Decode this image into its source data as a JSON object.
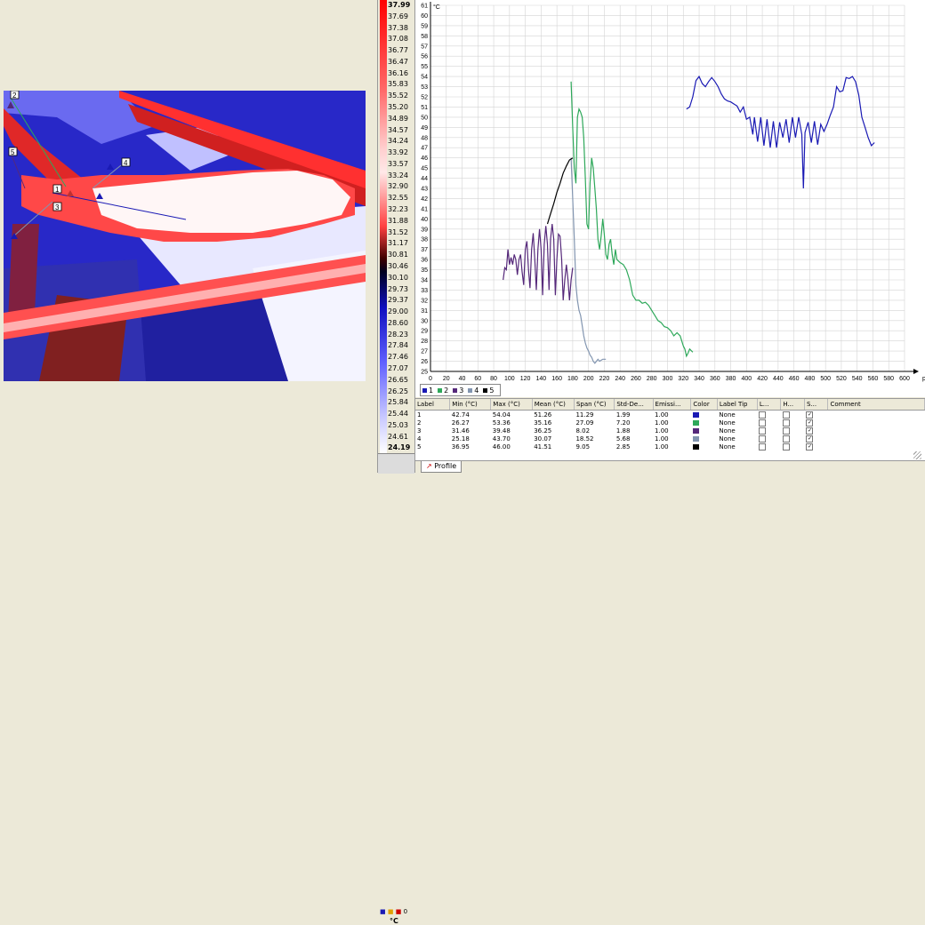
{
  "palette": {
    "ticks": [
      "37.99",
      "37.69",
      "37.38",
      "37.08",
      "36.77",
      "36.47",
      "36.16",
      "35.83",
      "35.52",
      "35.20",
      "34.89",
      "34.57",
      "34.24",
      "33.92",
      "33.57",
      "33.24",
      "32.90",
      "32.55",
      "32.23",
      "31.88",
      "31.52",
      "31.17",
      "30.81",
      "30.46",
      "30.10",
      "29.73",
      "29.37",
      "29.00",
      "28.60",
      "28.23",
      "27.84",
      "27.46",
      "27.07",
      "26.65",
      "26.25",
      "25.84",
      "25.44",
      "25.03",
      "24.61",
      "24.19"
    ],
    "unit": "°C",
    "dots_label": "0"
  },
  "image_markers": [
    "1",
    "2",
    "3",
    "4",
    "5"
  ],
  "chart_data": {
    "type": "line",
    "ylabel": "°C",
    "xlabel": "px",
    "xlim": [
      0,
      600
    ],
    "ylim": [
      25,
      61
    ],
    "xticks": [
      0,
      20,
      40,
      60,
      80,
      100,
      120,
      140,
      160,
      180,
      200,
      220,
      240,
      260,
      280,
      300,
      320,
      340,
      360,
      380,
      400,
      420,
      440,
      460,
      480,
      500,
      520,
      540,
      560,
      580,
      600
    ],
    "yticks": [
      25,
      26,
      27,
      28,
      29,
      30,
      31,
      32,
      33,
      34,
      35,
      36,
      37,
      38,
      39,
      40,
      41,
      42,
      43,
      44,
      45,
      46,
      47,
      48,
      49,
      50,
      51,
      52,
      53,
      54,
      55,
      56,
      57,
      58,
      59,
      60,
      61
    ],
    "series": [
      {
        "name": "1",
        "color": "#1a1ab4",
        "points": [
          [
            324,
            50.8
          ],
          [
            328,
            51
          ],
          [
            332,
            52
          ],
          [
            336,
            53.6
          ],
          [
            340,
            54
          ],
          [
            344,
            53.3
          ],
          [
            348,
            53
          ],
          [
            352,
            53.5
          ],
          [
            356,
            53.9
          ],
          [
            360,
            53.5
          ],
          [
            364,
            53
          ],
          [
            368,
            52.3
          ],
          [
            372,
            51.8
          ],
          [
            376,
            51.6
          ],
          [
            380,
            51.5
          ],
          [
            384,
            51.3
          ],
          [
            388,
            51.1
          ],
          [
            392,
            50.5
          ],
          [
            396,
            51
          ],
          [
            400,
            49.8
          ],
          [
            404,
            50
          ],
          [
            408,
            48.3
          ],
          [
            410,
            50
          ],
          [
            414,
            47.6
          ],
          [
            418,
            50
          ],
          [
            422,
            47.2
          ],
          [
            426,
            49.8
          ],
          [
            430,
            47
          ],
          [
            434,
            49.6
          ],
          [
            438,
            47
          ],
          [
            442,
            49.5
          ],
          [
            446,
            48
          ],
          [
            450,
            49.8
          ],
          [
            454,
            47.5
          ],
          [
            458,
            50
          ],
          [
            462,
            48
          ],
          [
            466,
            50
          ],
          [
            470,
            48.3
          ],
          [
            472,
            43
          ],
          [
            474,
            48.5
          ],
          [
            478,
            49.5
          ],
          [
            482,
            47.5
          ],
          [
            486,
            49.6
          ],
          [
            490,
            47.3
          ],
          [
            494,
            49.3
          ],
          [
            498,
            48.6
          ],
          [
            502,
            49.3
          ],
          [
            506,
            50.2
          ],
          [
            510,
            51
          ],
          [
            514,
            53
          ],
          [
            518,
            52.5
          ],
          [
            522,
            52.6
          ],
          [
            526,
            53.9
          ],
          [
            530,
            53.8
          ],
          [
            534,
            54
          ],
          [
            538,
            53.5
          ],
          [
            542,
            52.2
          ],
          [
            546,
            50
          ],
          [
            550,
            49
          ],
          [
            554,
            48
          ],
          [
            558,
            47.2
          ],
          [
            562,
            47.5
          ]
        ]
      },
      {
        "name": "2",
        "color": "#2ea85a",
        "points": [
          [
            178,
            53.5
          ],
          [
            180,
            49
          ],
          [
            182,
            45
          ],
          [
            184,
            43.5
          ],
          [
            186,
            50
          ],
          [
            188,
            50.8
          ],
          [
            190,
            50.5
          ],
          [
            192,
            50
          ],
          [
            194,
            48
          ],
          [
            196,
            44
          ],
          [
            198,
            39.5
          ],
          [
            200,
            39
          ],
          [
            202,
            43.5
          ],
          [
            204,
            46
          ],
          [
            206,
            45
          ],
          [
            208,
            43
          ],
          [
            210,
            41
          ],
          [
            212,
            38
          ],
          [
            214,
            37
          ],
          [
            216,
            38.3
          ],
          [
            218,
            40
          ],
          [
            220,
            38.5
          ],
          [
            222,
            36.5
          ],
          [
            224,
            36
          ],
          [
            226,
            37.5
          ],
          [
            228,
            38
          ],
          [
            230,
            36.5
          ],
          [
            232,
            35.5
          ],
          [
            234,
            37
          ],
          [
            236,
            36
          ],
          [
            240,
            35.7
          ],
          [
            244,
            35.5
          ],
          [
            248,
            35
          ],
          [
            252,
            34
          ],
          [
            256,
            32.5
          ],
          [
            260,
            32
          ],
          [
            264,
            32
          ],
          [
            268,
            31.7
          ],
          [
            272,
            31.8
          ],
          [
            276,
            31.5
          ],
          [
            280,
            31
          ],
          [
            284,
            30.5
          ],
          [
            288,
            30
          ],
          [
            292,
            29.8
          ],
          [
            296,
            29.4
          ],
          [
            300,
            29.3
          ],
          [
            304,
            29
          ],
          [
            308,
            28.5
          ],
          [
            312,
            28.8
          ],
          [
            316,
            28.5
          ],
          [
            320,
            27.5
          ],
          [
            322,
            27.2
          ],
          [
            324,
            26.5
          ],
          [
            326,
            26.8
          ],
          [
            328,
            27.2
          ],
          [
            332,
            26.9
          ]
        ]
      },
      {
        "name": "3",
        "color": "#55287a",
        "points": [
          [
            92,
            34
          ],
          [
            94,
            35.2
          ],
          [
            96,
            35
          ],
          [
            98,
            37
          ],
          [
            100,
            35.5
          ],
          [
            102,
            36.2
          ],
          [
            104,
            35.5
          ],
          [
            106,
            36.5
          ],
          [
            108,
            36
          ],
          [
            110,
            34.5
          ],
          [
            112,
            36
          ],
          [
            114,
            36.5
          ],
          [
            116,
            34.8
          ],
          [
            118,
            33.5
          ],
          [
            120,
            37
          ],
          [
            122,
            37.8
          ],
          [
            124,
            35
          ],
          [
            126,
            33.2
          ],
          [
            128,
            37
          ],
          [
            130,
            38.6
          ],
          [
            132,
            36
          ],
          [
            134,
            33
          ],
          [
            136,
            37
          ],
          [
            138,
            39
          ],
          [
            140,
            37
          ],
          [
            142,
            32.5
          ],
          [
            144,
            37.5
          ],
          [
            146,
            39.3
          ],
          [
            148,
            37.5
          ],
          [
            150,
            33
          ],
          [
            152,
            38
          ],
          [
            154,
            39.5
          ],
          [
            156,
            38
          ],
          [
            158,
            32.5
          ],
          [
            160,
            36
          ],
          [
            162,
            38.5
          ],
          [
            164,
            38.3
          ],
          [
            166,
            36
          ],
          [
            168,
            32
          ],
          [
            170,
            34
          ],
          [
            172,
            35.5
          ],
          [
            174,
            34
          ],
          [
            176,
            32
          ],
          [
            178,
            34
          ],
          [
            180,
            35.2
          ]
        ]
      },
      {
        "name": "4",
        "color": "#8295b0",
        "points": [
          [
            178,
            46
          ],
          [
            180,
            42
          ],
          [
            182,
            38
          ],
          [
            184,
            33.5
          ],
          [
            186,
            32
          ],
          [
            188,
            31
          ],
          [
            190,
            30.5
          ],
          [
            192,
            29.5
          ],
          [
            194,
            28.5
          ],
          [
            196,
            27.8
          ],
          [
            198,
            27.3
          ],
          [
            200,
            27
          ],
          [
            202,
            26.6
          ],
          [
            204,
            26.4
          ],
          [
            206,
            26
          ],
          [
            208,
            25.8
          ],
          [
            210,
            26
          ],
          [
            212,
            26.2
          ],
          [
            214,
            26
          ],
          [
            216,
            26.1
          ],
          [
            218,
            26.2
          ],
          [
            222,
            26.2
          ]
        ]
      },
      {
        "name": "5",
        "color": "#000000",
        "points": [
          [
            148,
            39.5
          ],
          [
            152,
            40.5
          ],
          [
            156,
            41.5
          ],
          [
            160,
            42.6
          ],
          [
            164,
            43.5
          ],
          [
            168,
            44.5
          ],
          [
            172,
            45.2
          ],
          [
            176,
            45.8
          ],
          [
            180,
            46
          ]
        ]
      }
    ]
  },
  "table": {
    "headers": [
      "Label",
      "Min (°C)",
      "Max (°C)",
      "Mean (°C)",
      "Span (°C)",
      "Std-De...",
      "Emissi...",
      "Color",
      "Label Tip",
      "L...",
      "H...",
      "S...",
      "Comment"
    ],
    "rows": [
      {
        "label": "1",
        "min": "42.74",
        "max": "54.04",
        "mean": "51.26",
        "span": "11.29",
        "std": "1.99",
        "emis": "1.00",
        "color": "#1a1ab4",
        "tip": "None",
        "s": "✓"
      },
      {
        "label": "2",
        "min": "26.27",
        "max": "53.36",
        "mean": "35.16",
        "span": "27.09",
        "std": "7.20",
        "emis": "1.00",
        "color": "#2ea85a",
        "tip": "None",
        "s": "✓"
      },
      {
        "label": "3",
        "min": "31.46",
        "max": "39.48",
        "mean": "36.25",
        "span": "8.02",
        "std": "1.88",
        "emis": "1.00",
        "color": "#55287a",
        "tip": "None",
        "s": "✓"
      },
      {
        "label": "4",
        "min": "25.18",
        "max": "43.70",
        "mean": "30.07",
        "span": "18.52",
        "std": "5.68",
        "emis": "1.00",
        "color": "#8295b0",
        "tip": "None",
        "s": "✓"
      },
      {
        "label": "5",
        "min": "36.95",
        "max": "46.00",
        "mean": "41.51",
        "span": "9.05",
        "std": "2.85",
        "emis": "1.00",
        "color": "#000000",
        "tip": "None",
        "s": "✓"
      }
    ]
  },
  "tabs": {
    "profile": "Profile"
  }
}
